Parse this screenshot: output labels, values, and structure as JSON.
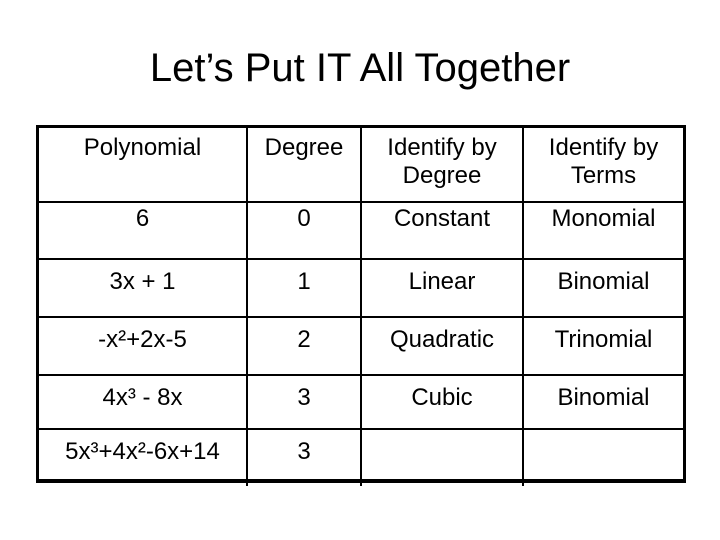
{
  "slide": {
    "title": "Let’s Put IT All Together"
  },
  "table": {
    "headers": [
      {
        "lines": [
          "Polynomial"
        ]
      },
      {
        "lines": [
          "Degree"
        ]
      },
      {
        "lines": [
          "Identify by",
          "Degree"
        ]
      },
      {
        "lines": [
          "Identify by",
          "Terms"
        ]
      }
    ],
    "rows": [
      {
        "polynomial": "6",
        "degree": "0",
        "by_degree": "Constant",
        "by_terms": "Monomial"
      },
      {
        "polynomial": "3x + 1",
        "degree": "1",
        "by_degree": "Linear",
        "by_terms": "Binomial"
      },
      {
        "polynomial": "-x²+2x-5",
        "degree": "2",
        "by_degree": "Quadratic",
        "by_terms": "Trinomial"
      },
      {
        "polynomial": "4x³ - 8x",
        "degree": "3",
        "by_degree": "Cubic",
        "by_terms": "Binomial"
      },
      {
        "polynomial": "5x³+4x²-6x+14",
        "degree": "3",
        "by_degree": "",
        "by_terms": ""
      }
    ]
  }
}
